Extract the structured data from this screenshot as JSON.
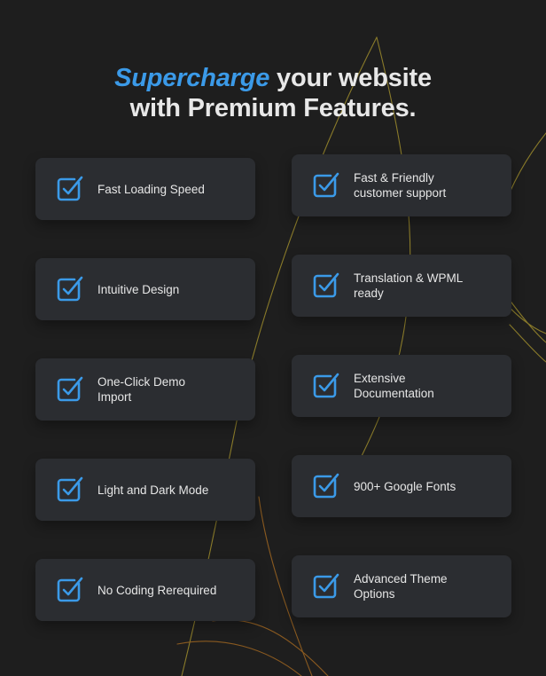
{
  "heading": {
    "accent_word": "Supercharge",
    "line1_rest": " your website",
    "line2": "with Premium Features."
  },
  "colors": {
    "page_background": "#1e1e1e",
    "card_background": "#2b2d31",
    "accent_blue": "#3b9ae8",
    "heading_text": "#e8e8e8",
    "card_text": "#e6e6e6",
    "curve_olive": "#8a7b2a",
    "curve_amber": "#8a5a20"
  },
  "features": {
    "left_column": [
      {
        "label": "Fast Loading Speed",
        "icon": "check-square-icon"
      },
      {
        "label": "Intuitive Design",
        "icon": "check-square-icon"
      },
      {
        "label": "One-Click Demo\nImport",
        "icon": "check-square-icon"
      },
      {
        "label": "Light and Dark Mode",
        "icon": "check-square-icon"
      },
      {
        "label": "No Coding Rerequired",
        "icon": "check-square-icon"
      }
    ],
    "right_column": [
      {
        "label": "Fast & Friendly\ncustomer support",
        "icon": "check-square-icon"
      },
      {
        "label": "Translation & WPML\nready",
        "icon": "check-square-icon"
      },
      {
        "label": "Extensive\nDocumentation",
        "icon": "check-square-icon"
      },
      {
        "label": "900+ Google Fonts",
        "icon": "check-square-icon"
      },
      {
        "label": "Advanced Theme\nOptions",
        "icon": "check-square-icon"
      }
    ]
  }
}
